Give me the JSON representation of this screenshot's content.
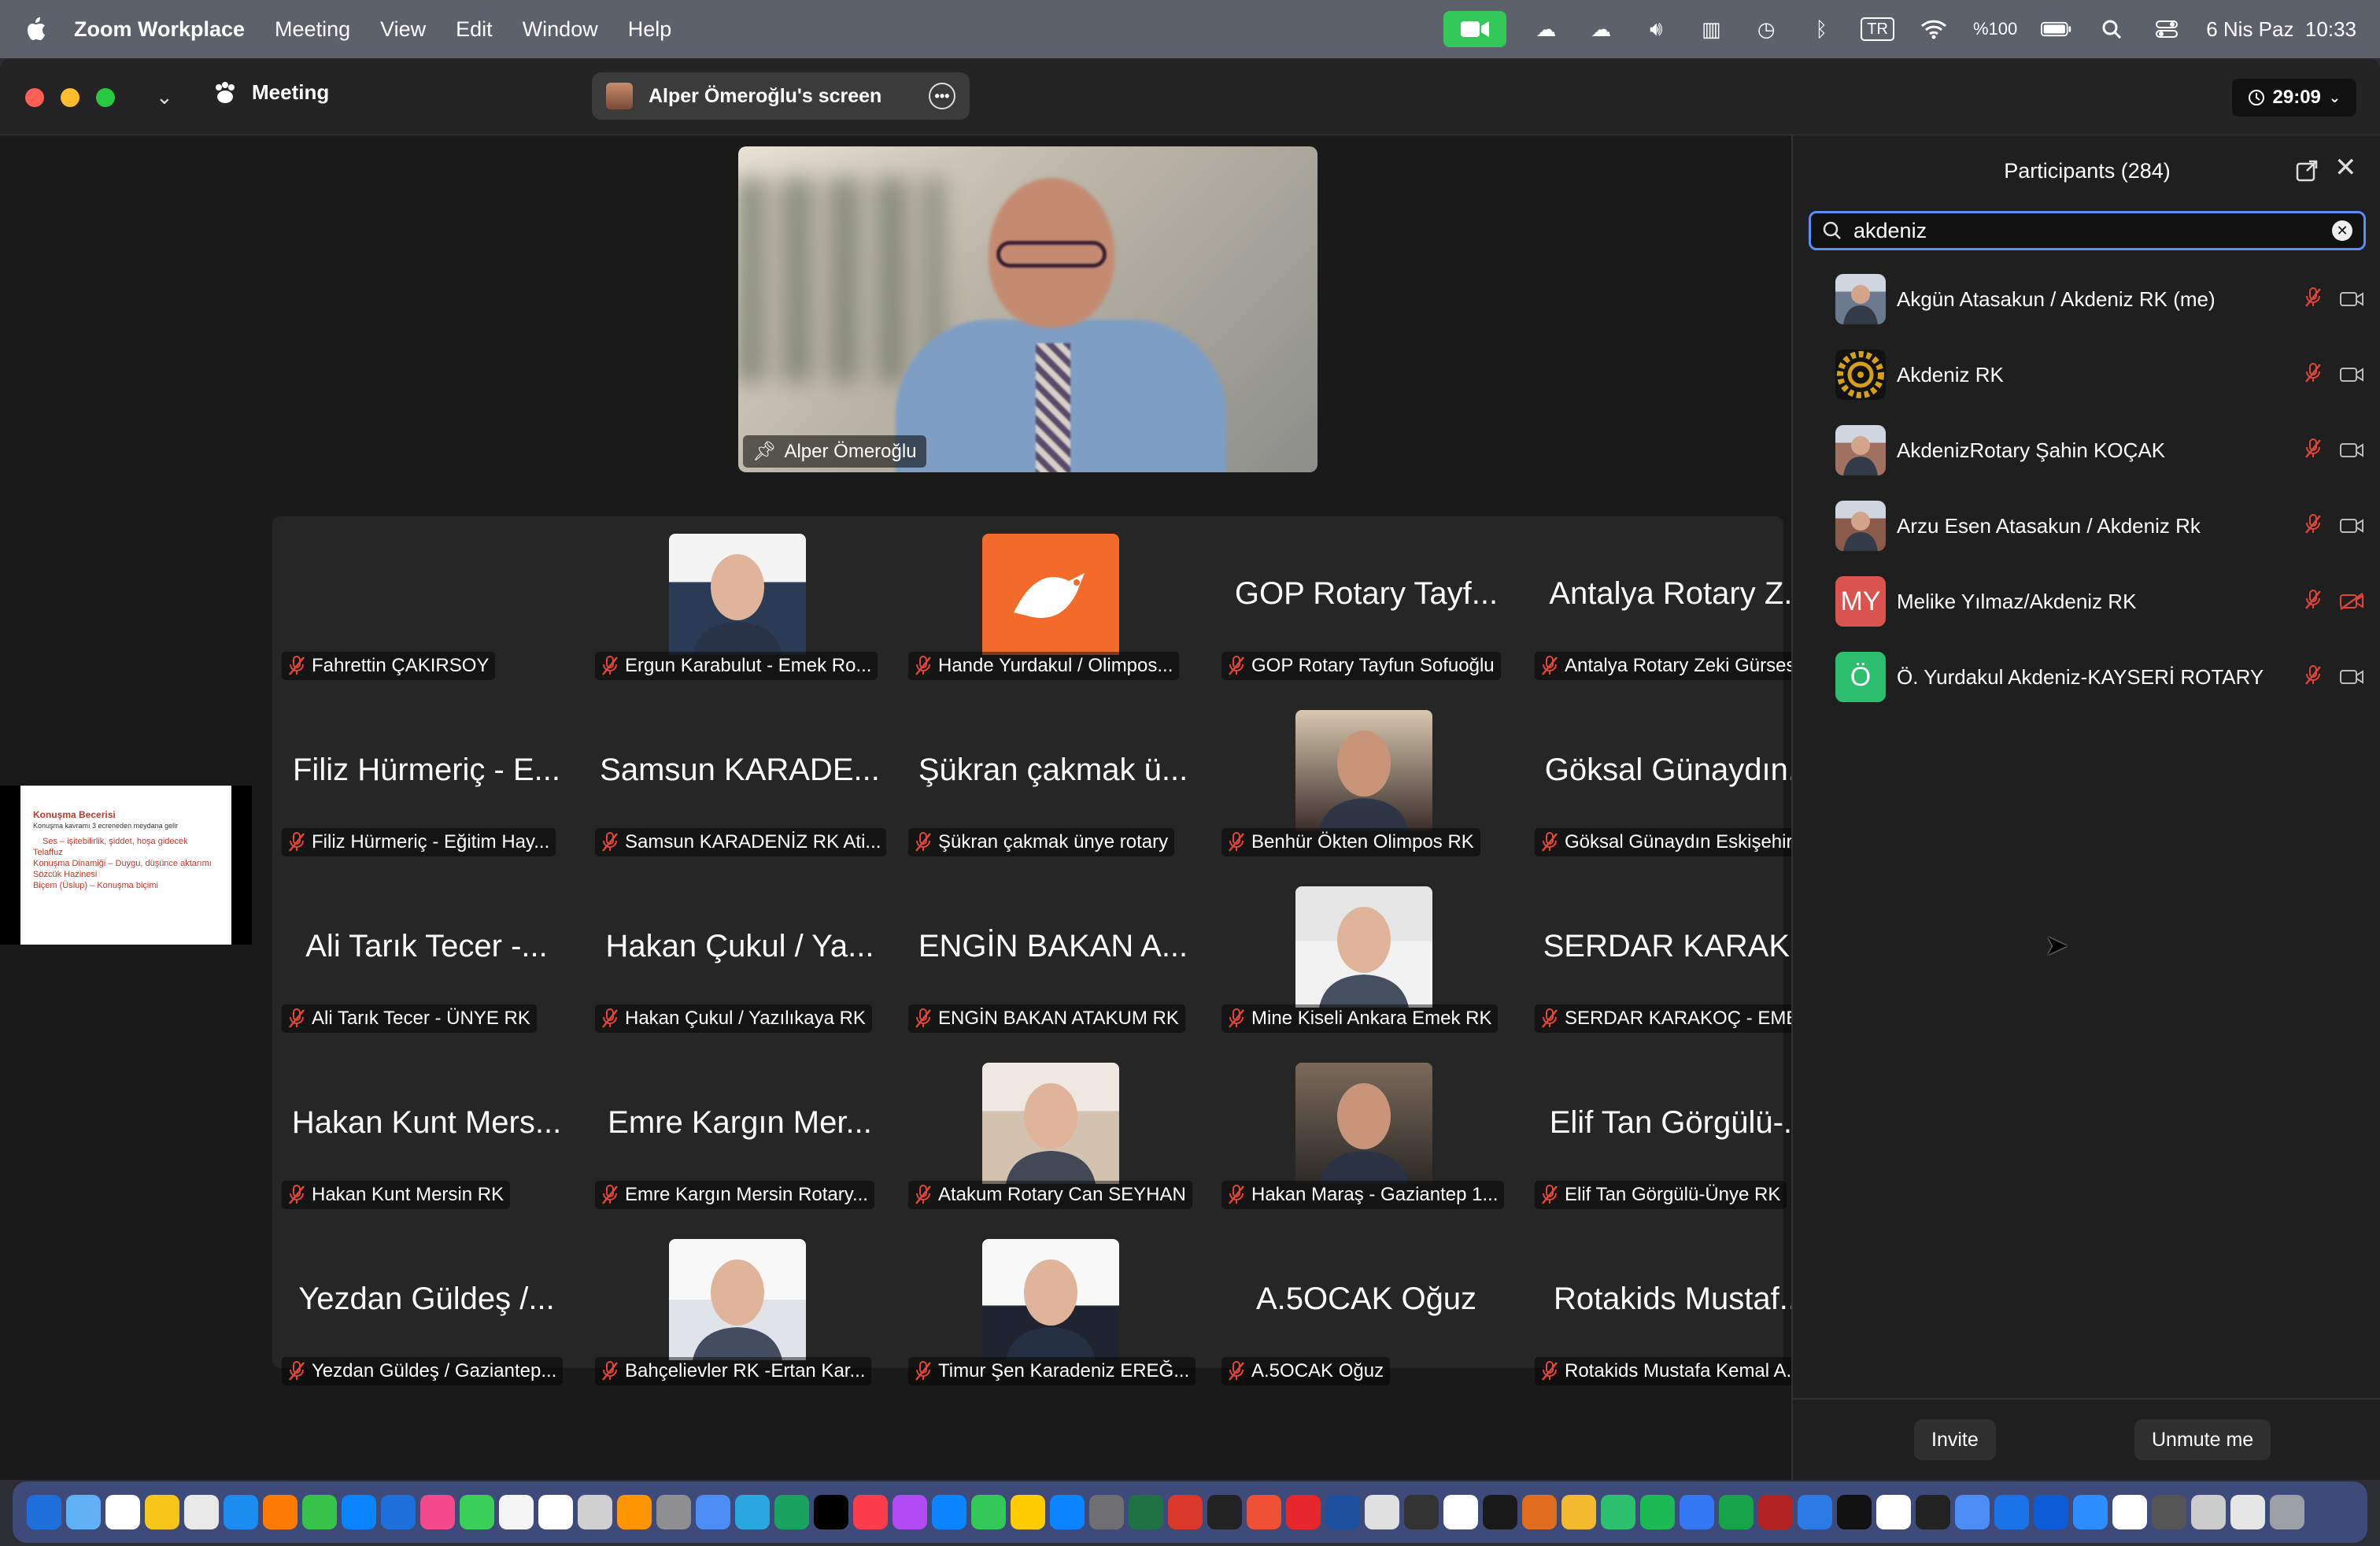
{
  "menubar": {
    "app_name": "Zoom Workplace",
    "items": [
      "Meeting",
      "View",
      "Edit",
      "Window",
      "Help"
    ],
    "keyboard": "TR",
    "battery": "%100",
    "datetime": "6 Nis Paz  10:33"
  },
  "toolbar": {
    "meeting_label": "Meeting",
    "share_label": "Alper Ömeroğlu's screen",
    "timer": "29:09"
  },
  "speaker": {
    "name": "Alper Ömeroğlu"
  },
  "gallery": [
    {
      "big": "",
      "name": "Fahrettin ÇAKIRSOY",
      "photo": false
    },
    {
      "big": "",
      "name": "Ergun Karabulut - Emek Ro...",
      "photo": "man-suit"
    },
    {
      "big": "",
      "name": "Hande Yurdakul / Olimpos...",
      "photo": "rotary-orange"
    },
    {
      "big": "GOP Rotary Tayf...",
      "name": "GOP Rotary Tayfun Sofuoğlu",
      "photo": false
    },
    {
      "big": "Antalya Rotary Z...",
      "name": "Antalya Rotary Zeki Gürses",
      "photo": false
    },
    {
      "big": "Filiz Hürmeriç - E...",
      "name": "Filiz Hürmeriç - Eğitim Hay...",
      "photo": false
    },
    {
      "big": "Samsun KARADE...",
      "name": "Samsun KARADENİZ RK Ati...",
      "photo": false
    },
    {
      "big": "Şükran çakmak ü...",
      "name": "Şükran çakmak ünye rotary",
      "photo": false
    },
    {
      "big": "",
      "name": "Benhür Ökten Olimpos RK",
      "photo": "man-tux"
    },
    {
      "big": "Göksal Günaydın...",
      "name": "Göksal Günaydın Eskişehir...",
      "photo": false
    },
    {
      "big": "Ali Tarık Tecer -...",
      "name": "Ali Tarık Tecer - ÜNYE RK",
      "photo": false
    },
    {
      "big": "Hakan Çukul / Ya...",
      "name": "Hakan Çukul / Yazılıkaya RK",
      "photo": false
    },
    {
      "big": "ENGİN BAKAN A...",
      "name": "ENGİN BAKAN ATAKUM RK",
      "photo": false
    },
    {
      "big": "",
      "name": "Mine Kiseli Ankara Emek RK",
      "photo": "woman"
    },
    {
      "big": "SERDAR KARAK...",
      "name": "SERDAR KARAKOÇ - EMEK...",
      "photo": false
    },
    {
      "big": "Hakan Kunt Mers...",
      "name": "Hakan Kunt Mersin RK",
      "photo": false
    },
    {
      "big": "Emre Kargın Mer...",
      "name": "Emre Kargın Mersin Rotary...",
      "photo": false
    },
    {
      "big": "",
      "name": "Atakum Rotary Can SEYHAN",
      "photo": "man-beard"
    },
    {
      "big": "",
      "name": "Hakan Maraş - Gaziantep 1...",
      "photo": "man-bald"
    },
    {
      "big": "Elif Tan Görgülü-...",
      "name": "Elif Tan Görgülü-Ünye RK",
      "photo": false
    },
    {
      "big": "Yezdan Güldeş /...",
      "name": "Yezdan Güldeş / Gaziantep...",
      "photo": false
    },
    {
      "big": "",
      "name": "Bahçelievler RK -Ertan Kar...",
      "photo": "man-white"
    },
    {
      "big": "",
      "name": "Timur Şen Karadeniz EREĞ...",
      "photo": "man-young"
    },
    {
      "big": "A.5OCAK Oğuz",
      "name": "A.5OCAK Oğuz",
      "photo": false
    },
    {
      "big": "Rotakids Mustaf...",
      "name": "Rotakids Mustafa Kemal A...",
      "photo": false
    }
  ],
  "slide_thumb": {
    "title": "Konuşma Becerisi",
    "sub": "Konuşma kavramı 3 ecreneden meydana gelir",
    "lines": [
      "Ses – işitebilirlik, şiddet, hoşa gidecek",
      "Telaffuz",
      "Konuşma Dinamiği – Duygu, düşünce aktarımı",
      "Sözcük Hazinesi",
      "Biçem (Üslup) – Konuşma biçimi"
    ]
  },
  "panel": {
    "title": "Participants (284)",
    "search_value": "akdeniz",
    "participants": [
      {
        "name": "Akgün Atasakun / Akdeniz RK (me)",
        "avatar": "photo",
        "initials": "",
        "avatar_color": "#6b7a8f",
        "cam_off": false
      },
      {
        "name": "Akdeniz RK",
        "avatar": "rotary",
        "initials": "",
        "avatar_color": "#d4a017",
        "cam_off": false
      },
      {
        "name": "AkdenizRotary Şahin KOÇAK",
        "avatar": "photo",
        "initials": "",
        "avatar_color": "#a07060",
        "cam_off": false
      },
      {
        "name": "Arzu Esen Atasakun / Akdeniz Rk",
        "avatar": "photo",
        "initials": "",
        "avatar_color": "#8a5a4a",
        "cam_off": false
      },
      {
        "name": "Melike Yılmaz/Akdeniz RK",
        "avatar": "initials",
        "initials": "MY",
        "avatar_color": "#d9534f",
        "cam_off": true
      },
      {
        "name": "Ö. Yurdakul Akdeniz-KAYSERİ ROTARY",
        "avatar": "initials",
        "initials": "Ö",
        "avatar_color": "#2dbd6e",
        "cam_off": false
      }
    ],
    "invite_label": "Invite",
    "unmute_label": "Unmute me"
  },
  "colors": {
    "accent": "#5a8ef5",
    "muted_red": "#e0453a",
    "zoom_green": "#34c759"
  }
}
